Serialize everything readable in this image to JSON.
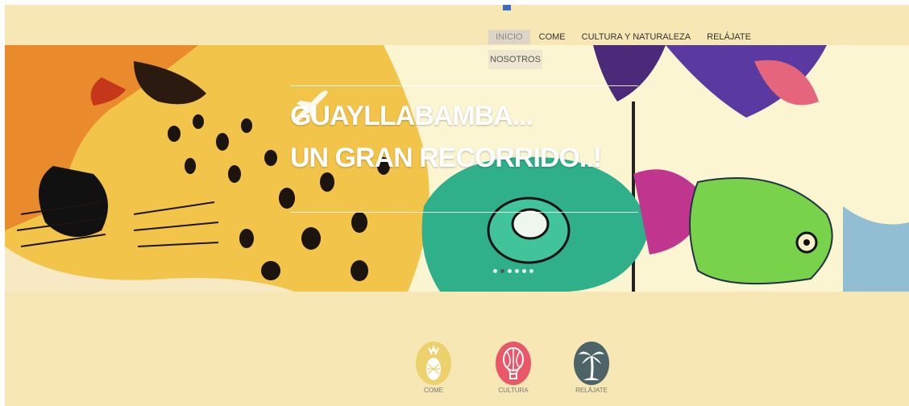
{
  "nav": {
    "items": [
      {
        "label": "INICIO",
        "active": true
      },
      {
        "label": "COME",
        "active": false
      },
      {
        "label": "CULTURA Y NATURALEZA",
        "active": false
      },
      {
        "label": "RELÁJATE",
        "active": false
      }
    ],
    "overflow_item": "NOSOTROS"
  },
  "hero": {
    "line1": "GUAYLLABAMBA...",
    "line2": "UN GRAN RECORRIDO..!",
    "icon": "airplane-icon",
    "slides": 6,
    "active_slide": 2
  },
  "categories": [
    {
      "label": "COME",
      "icon": "pineapple-icon",
      "color": "#ecd16d"
    },
    {
      "label": "CULTURA",
      "icon": "hot-air-balloon-icon",
      "color": "#e85868"
    },
    {
      "label": "RELÁJATE",
      "icon": "palm-tree-icon",
      "color": "#4c6368"
    }
  ],
  "colors": {
    "page_background": "#f6e7b4",
    "nav_active": "#ddd6c6"
  }
}
